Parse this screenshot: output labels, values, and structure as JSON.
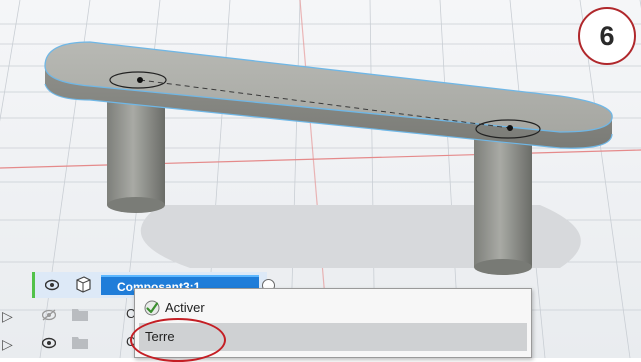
{
  "step": {
    "number": "6"
  },
  "browser": {
    "selected_component": "Composant3:1",
    "row2_letter": "C",
    "row3_letter": "C"
  },
  "context_menu": {
    "items": [
      {
        "label": "Activer",
        "icon": "check-icon"
      },
      {
        "label": "Terre"
      }
    ]
  },
  "colors": {
    "accent_blue": "#1f7dd9",
    "highlight_red": "#c41e24",
    "active_green": "#52c24a"
  }
}
